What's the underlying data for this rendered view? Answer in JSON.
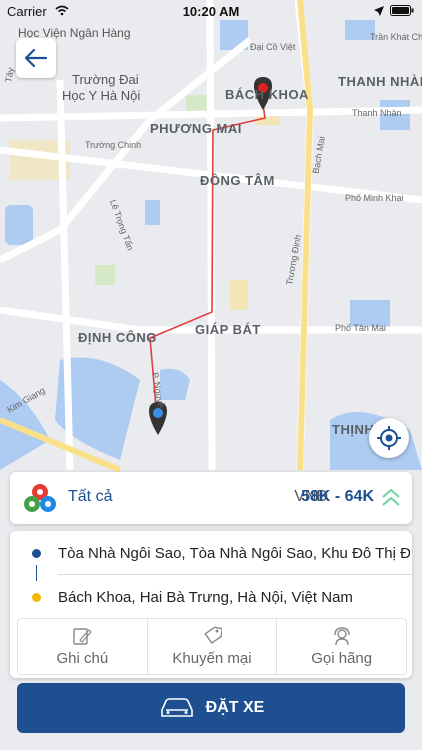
{
  "status_bar": {
    "carrier": "Carrier",
    "time": "10:20 AM"
  },
  "map": {
    "labels": {
      "hoc_vien": "Học Viện Ngân Hàng",
      "truong_dai_hoc_1": "Trường Đai",
      "truong_dai_hoc_2": "Học Y Hà Nội",
      "dai_co_viet": "Đại Cồ Việt",
      "tran_khat_chan": "Trần Khát Châ",
      "bach_khoa": "BÁCH KHOA",
      "thanh_nhan_area": "THANH NHÀN",
      "thanh_nhan_road": "Thanh Nhàn",
      "phuong_mai": "PHƯƠNG MAI",
      "truong_chinh": "Trường Chinh",
      "dong_tam": "ĐỒNG TÂM",
      "pho_minh_khai": "Phố Minh Khai",
      "bach_mai": "Bạch Mai",
      "le_trong_tan": "Lê Trọng Tấn",
      "truong_dinh": "Trương Định",
      "dinh_cong": "ĐỊNH CÔNG",
      "giap_bat": "GIÁP BÁT",
      "pho_tan_mai": "Phố Tân Mai",
      "kim_giang": "Kim Giang",
      "thinh": "THỊNH",
      "p_nguyen": "P. Nguyễ",
      "tay": "Tây"
    }
  },
  "vehicle": {
    "name": "Tất cả",
    "currency": "VNĐ",
    "price_range": "58K - 64K"
  },
  "route": {
    "pickup": "Tòa Nhà Ngôi Sao, Tòa Nhà Ngôi Sao, Khu Đô Thị Đ...",
    "destination": "Bách Khoa, Hai Bà Trưng, Hà Nội, Việt Nam"
  },
  "actions": {
    "note": "Ghi chú",
    "promo": "Khuyến mại",
    "call": "Gọi hãng"
  },
  "book_button": "ĐẶT XE",
  "colors": {
    "primary": "#1d4f91",
    "pickup_dot": "#1d4f91",
    "destination_dot": "#f2b705",
    "route": "#e04040"
  }
}
